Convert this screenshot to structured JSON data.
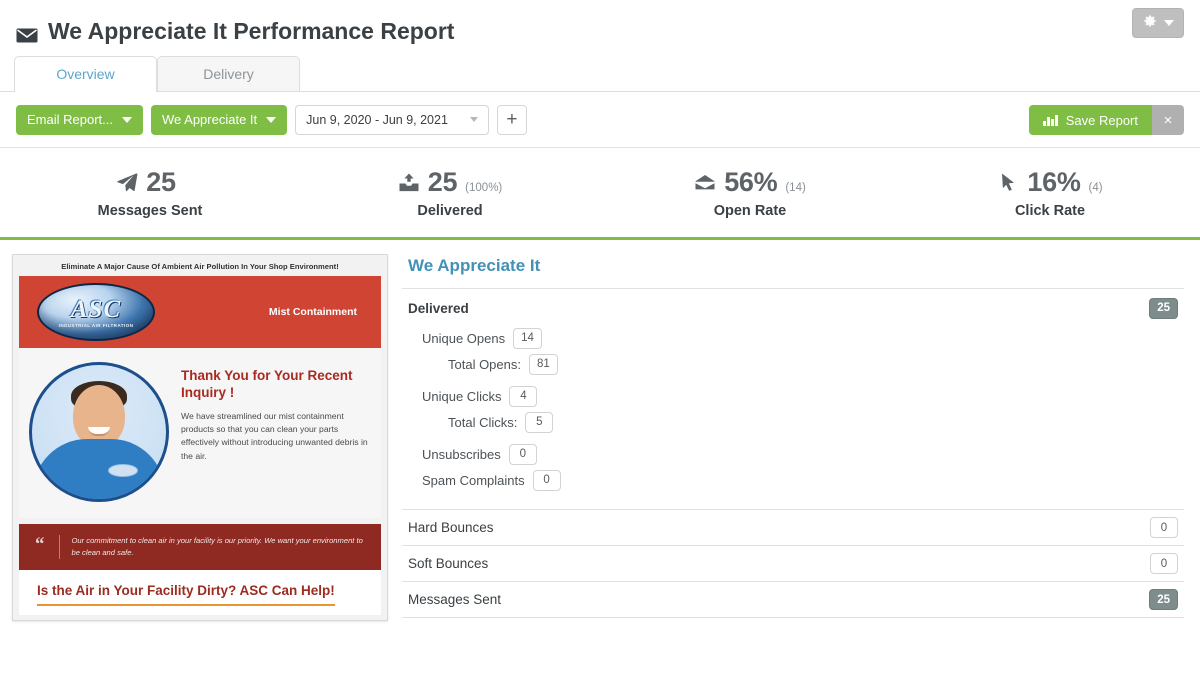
{
  "header": {
    "title": "We Appreciate It Performance Report",
    "envelope_icon": "envelope-icon",
    "gear_icon": "gear-icon",
    "gear_caret_icon": "chevron-down-icon"
  },
  "tabs": [
    {
      "label": "Overview",
      "active": true
    },
    {
      "label": "Delivery",
      "active": false
    }
  ],
  "toolbar": {
    "email_report_label": "Email Report...",
    "campaign_label": "We Appreciate It",
    "date_range": "Jun 9, 2020 - Jun 9, 2021",
    "add_label": "+",
    "save_report_label": "Save Report",
    "save_report_icon": "bar-chart-icon",
    "close_label": "×",
    "accent_green": "#7fbd45",
    "close_grey": "#b0b0b0"
  },
  "stats": [
    {
      "icon": "paper-plane-icon",
      "value": "25",
      "sub": "",
      "label": "Messages Sent"
    },
    {
      "icon": "inbox-download-icon",
      "value": "25",
      "sub": "(100%)",
      "label": "Delivered"
    },
    {
      "icon": "open-envelope-icon",
      "value": "56%",
      "sub": "(14)",
      "label": "Open Rate"
    },
    {
      "icon": "cursor-arrow-icon",
      "value": "16%",
      "sub": "(4)",
      "label": "Click Rate"
    }
  ],
  "preview": {
    "tagline": "Eliminate A Major Cause Of Ambient Air Pollution In Your Shop Environment!",
    "logo_word": "ASC",
    "logo_sub": "INDUSTRIAL AIR FILTRATION",
    "banner_title": "Mist Containment",
    "headline": "Thank You for Your Recent Inquiry !",
    "paragraph": "We have streamlined our mist containment products so that you can clean your parts effectively without introducing unwanted debris in the air.",
    "quote_mark": "“",
    "quote": "Our commitment to clean air in your facility is our priority.  We want your environment to be clean and safe.",
    "cta": "Is the Air in Your Facility Dirty?  ASC Can Help!",
    "banner_color": "#cf4433",
    "quote_color": "#8e2a22",
    "cta_color": "#9c2b20",
    "cta_underline_color": "#e8952f"
  },
  "metrics": {
    "title": "We Appreciate It",
    "title_color": "#4391b5",
    "delivered": {
      "label": "Delivered",
      "value": "25",
      "children": [
        {
          "label": "Unique Opens",
          "value": "14",
          "level": 1
        },
        {
          "label": "Total Opens:",
          "value": "81",
          "level": 2
        },
        {
          "label": "Unique Clicks",
          "value": "4",
          "level": 1
        },
        {
          "label": "Total Clicks:",
          "value": "5",
          "level": 2
        },
        {
          "label": "Unsubscribes",
          "value": "0",
          "level": 1
        },
        {
          "label": "Spam Complaints",
          "value": "0",
          "level": 1
        }
      ]
    },
    "rows": [
      {
        "label": "Hard Bounces",
        "value": "0",
        "dark": false
      },
      {
        "label": "Soft Bounces",
        "value": "0",
        "dark": false
      },
      {
        "label": "Messages Sent",
        "value": "25",
        "dark": true
      }
    ]
  }
}
